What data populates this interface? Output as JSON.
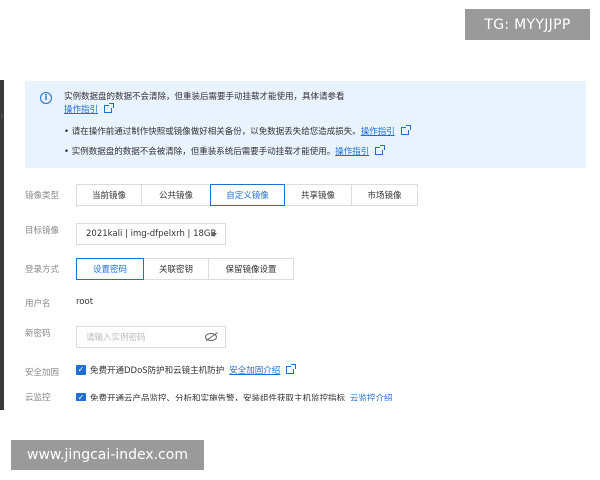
{
  "watermarks": {
    "top": "TG: MYYJJPP",
    "bottom": "www.jingcai-index.com"
  },
  "notice": {
    "line1": "实例数据盘的数据不会清除，但重装后需要手动挂载才能使用，具体请参看",
    "line1_link": "操作指引",
    "bullet1": "• 请在操作前通过制作快照或镜像做好相关备份，以免数据丢失给您造成损失。",
    "bullet1_link": "操作指引",
    "bullet2": "• 实例数据盘的数据不会被清除，但重装系统后需要手动挂载才能使用。",
    "bullet2_link": "操作指引"
  },
  "form": {
    "image_type": {
      "label": "镜像类型",
      "options": [
        "当前镜像",
        "公共镜像",
        "自定义镜像",
        "共享镜像",
        "市场镜像"
      ],
      "selected": "自定义镜像"
    },
    "target_image": {
      "label": "目标镜像",
      "value": "2021kali | img-dfpelxrh | 18GB"
    },
    "login_method": {
      "label": "登录方式",
      "options": [
        "设置密码",
        "关联密钥",
        "保留镜像设置"
      ],
      "selected": "设置密码"
    },
    "username": {
      "label": "用户名",
      "value": "root"
    },
    "new_password": {
      "label": "新密码",
      "placeholder": "请输入实例密码"
    },
    "security": {
      "label": "安全加固",
      "checkbox_label": "免费开通DDoS防护和云镜主机防护",
      "link": "安全加固介绍"
    },
    "monitoring": {
      "label": "云监控",
      "checkbox_label": "免费开通云产品监控、分析和实施告警，安装组件获取主机监控指标",
      "link": "云监控介绍"
    }
  },
  "colors": {
    "accent": "#1f6fd1",
    "notice_bg": "#e8f3fe",
    "watermark_bg": "#9a9a9a"
  }
}
